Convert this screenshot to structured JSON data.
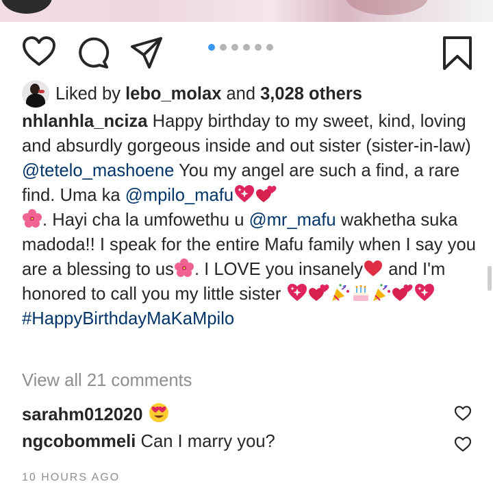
{
  "post": {
    "likes": {
      "prefix": "Liked by",
      "liker": "lebo_molax",
      "connector": "and",
      "others": "3,028 others"
    },
    "caption": {
      "username": "nhlanhla_nciza",
      "part1": " Happy birthday to my sweet, kind, loving and absurdly gorgeous inside and out sister (sister-in-law) ",
      "mention1": "@tetelo_mashoene",
      "part2": " You my angel are such a find, a rare find. Uma ka ",
      "mention2": "@mpilo_mafu",
      "part3": ". Hayi cha la umfowethu u ",
      "mention3": "@mr_mafu",
      "part4": " wakhetha suka madoda!! I speak for the entire Mafu family when I say you are a blessing to us",
      "part5": ". I LOVE you insanely",
      "part6": " and I'm honored to call you my little sister ",
      "hashtag": "#HappyBirthdayMaKaMpilo"
    },
    "view_all_comments": "View all 21 comments",
    "comments": [
      {
        "username": "sarahm012020",
        "text": ""
      },
      {
        "username": "ngcobommeli",
        "text": "Can I marry you?"
      }
    ],
    "timestamp": "10 HOURS AGO",
    "carousel": {
      "count": 6,
      "active_index": 0
    }
  },
  "colors": {
    "text": "#262626",
    "link": "#003569",
    "muted": "#8e8e8e",
    "dot_active": "#3897f0",
    "dot_inactive": "#b5b5b5"
  },
  "icons": {
    "actions": [
      "heart-icon",
      "comment-icon",
      "share-icon",
      "bookmark-icon"
    ],
    "emoji": [
      "sparkling-heart-emoji",
      "two-hearts-emoji",
      "hibiscus-emoji",
      "red-heart-emoji",
      "confetti-emoji",
      "birthday-cake-emoji",
      "heart-eyes-emoji"
    ]
  }
}
